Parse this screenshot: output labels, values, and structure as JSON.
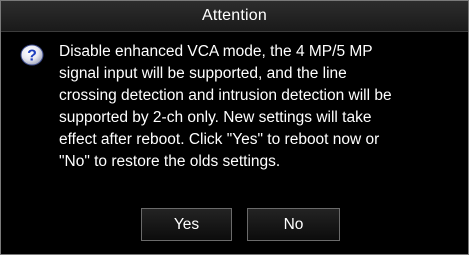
{
  "dialog": {
    "title": "Attention",
    "icon": "question-icon",
    "message_lines": [
      "Disable enhanced VCA mode, the 4 MP/5 MP",
      "signal input will be supported, and the line",
      "crossing detection and intrusion detection will be",
      "supported by 2-ch only. New settings will take",
      "effect after reboot. Click \"Yes\" to reboot now or",
      "\"No\" to restore the olds settings."
    ],
    "yes_label": "Yes",
    "no_label": "No"
  },
  "colors": {
    "background": "#000000",
    "text": "#ffffff",
    "icon_blue": "#1f3fbf"
  }
}
